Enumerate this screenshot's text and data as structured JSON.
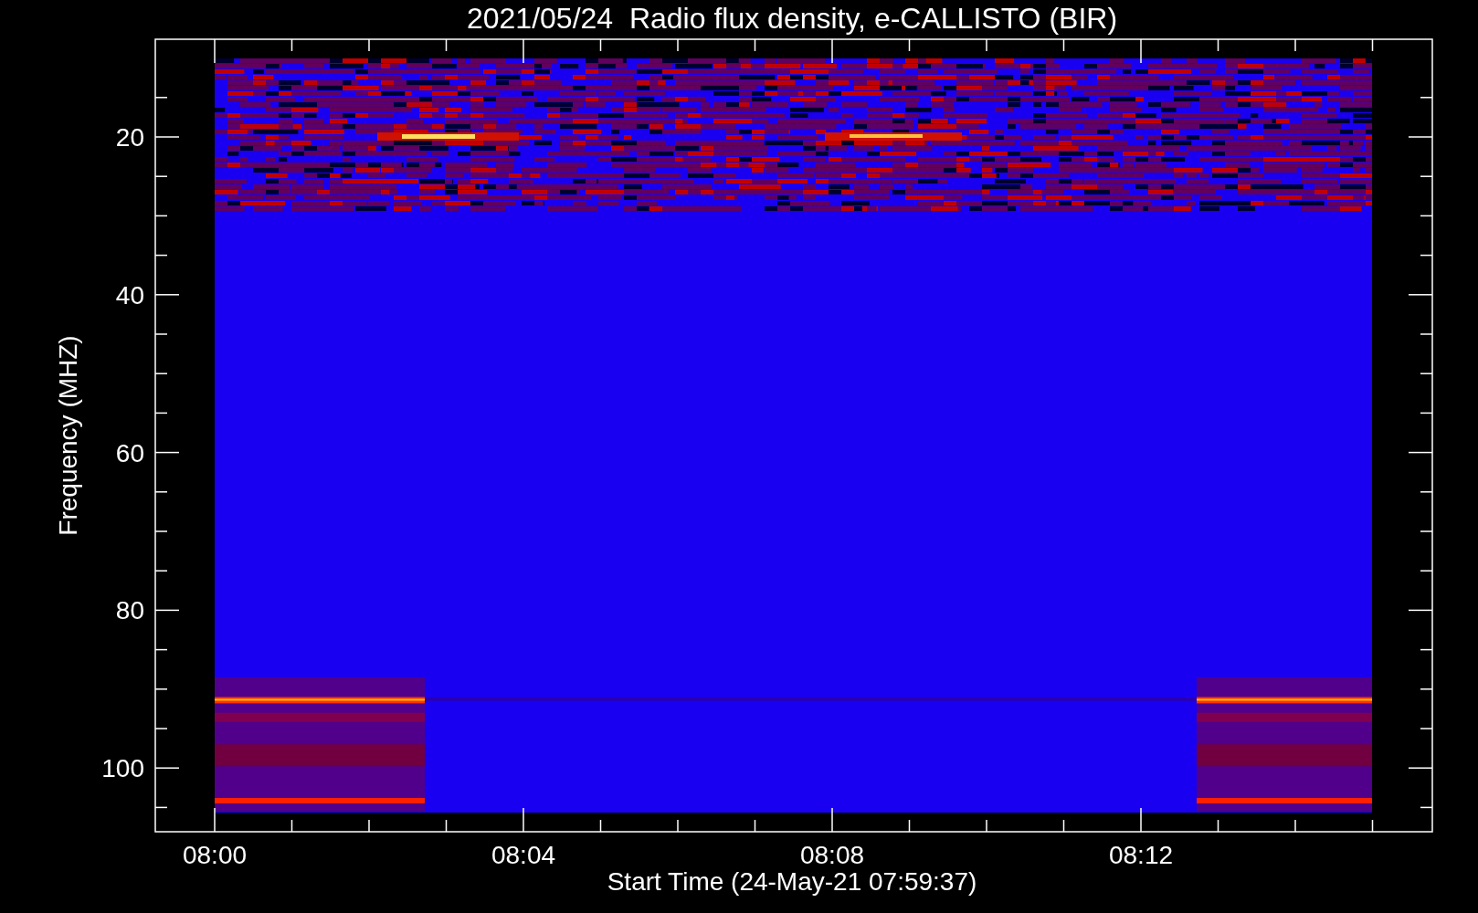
{
  "title": "2021/05/24  Radio flux density, e-CALLISTO (BIR)",
  "ylabel": "Frequency (MHZ)",
  "xlabel": "Start Time (24-May-21 07:59:37)",
  "yticks": [
    "20",
    "40",
    "60",
    "80",
    "100"
  ],
  "xticks": [
    "08:00",
    "08:04",
    "08:08",
    "08:12"
  ]
}
